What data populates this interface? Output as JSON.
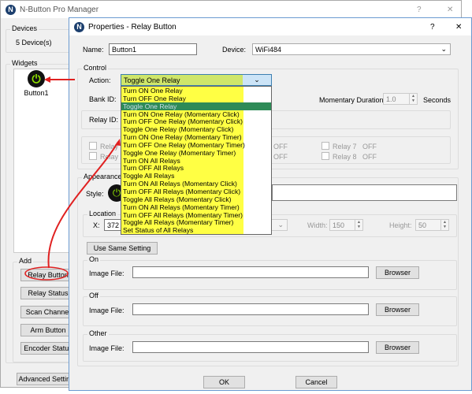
{
  "main": {
    "title": "N-Button Pro Manager",
    "help": "?",
    "close": "✕",
    "devices_label": "Devices",
    "devices_count": "5 Device(s)",
    "widgets_label": "Widgets",
    "widget_name": "Button1",
    "add_label": "Add",
    "add_buttons": [
      "Relay Button",
      "Relay Status",
      "Scan Channel",
      "Arm Button",
      "Encoder Status"
    ],
    "advanced": "Advanced Settings"
  },
  "dialog": {
    "title": "Properties - Relay Button",
    "help": "?",
    "close": "✕",
    "name_label": "Name:",
    "name_value": "Button1",
    "device_label": "Device:",
    "device_value": "WiFi484",
    "control_label": "Control",
    "action_label": "Action:",
    "action_value": "Toggle One Relay",
    "action_options": [
      "Turn ON One Relay",
      "Turn OFF One Relay",
      "Toggle One Relay",
      "Turn ON One Relay (Momentary Click)",
      "Turn OFF One Relay (Momentary Click)",
      "Toggle One Relay (Momentary Click)",
      "Turn ON One Relay  (Momentary Timer)",
      "Turn OFF One Relay (Momentary Timer)",
      "Toggle One Relay (Momentary Timer)",
      "Turn ON All Relays",
      "Turn OFF All Relays",
      "Toggle All Relays",
      "Turn ON All Relays (Momentary Click)",
      "Turn OFF All Relays (Momentary Click)",
      "Toggle All Relays (Momentary Click)",
      "Turn ON All Relays  (Momentary Timer)",
      "Turn OFF All Relays (Momentary Timer)",
      "Toggle All Relays (Momentary Timer)",
      "Set Status of All Relays"
    ],
    "bank_label": "Bank ID:",
    "relay_id_label": "Relay ID:",
    "duration_label": "Momentary Duration:",
    "duration_value": "1.0",
    "seconds": "Seconds",
    "relays": [
      {
        "label": "Relay 1",
        "state": "OFF"
      },
      {
        "label": "Relay 2",
        "state": "OFF"
      },
      {
        "label": "Relay 7",
        "state": "OFF"
      },
      {
        "label": "Relay 8",
        "state": "OFF"
      }
    ],
    "appearance_label": "Appearance",
    "style_label": "Style:",
    "location_label": "Location",
    "x_label": "X:",
    "x_value": "372",
    "width_label": "Width:",
    "width_value": "150",
    "height_label": "Height:",
    "height_value": "50",
    "same_setting": "Use Same Setting",
    "image_groups": [
      {
        "label": "On",
        "field": "Image File:",
        "button": "Browser"
      },
      {
        "label": "Off",
        "field": "Image File:",
        "button": "Browser"
      },
      {
        "label": "Other",
        "field": "Image File:",
        "button": "Browser"
      }
    ],
    "ok": "OK",
    "cancel": "Cancel"
  },
  "colors": {
    "highlight": "#ffff44",
    "selected": "#2e8b57",
    "annotation": "#e02020",
    "icon_green": "#8fe000"
  }
}
